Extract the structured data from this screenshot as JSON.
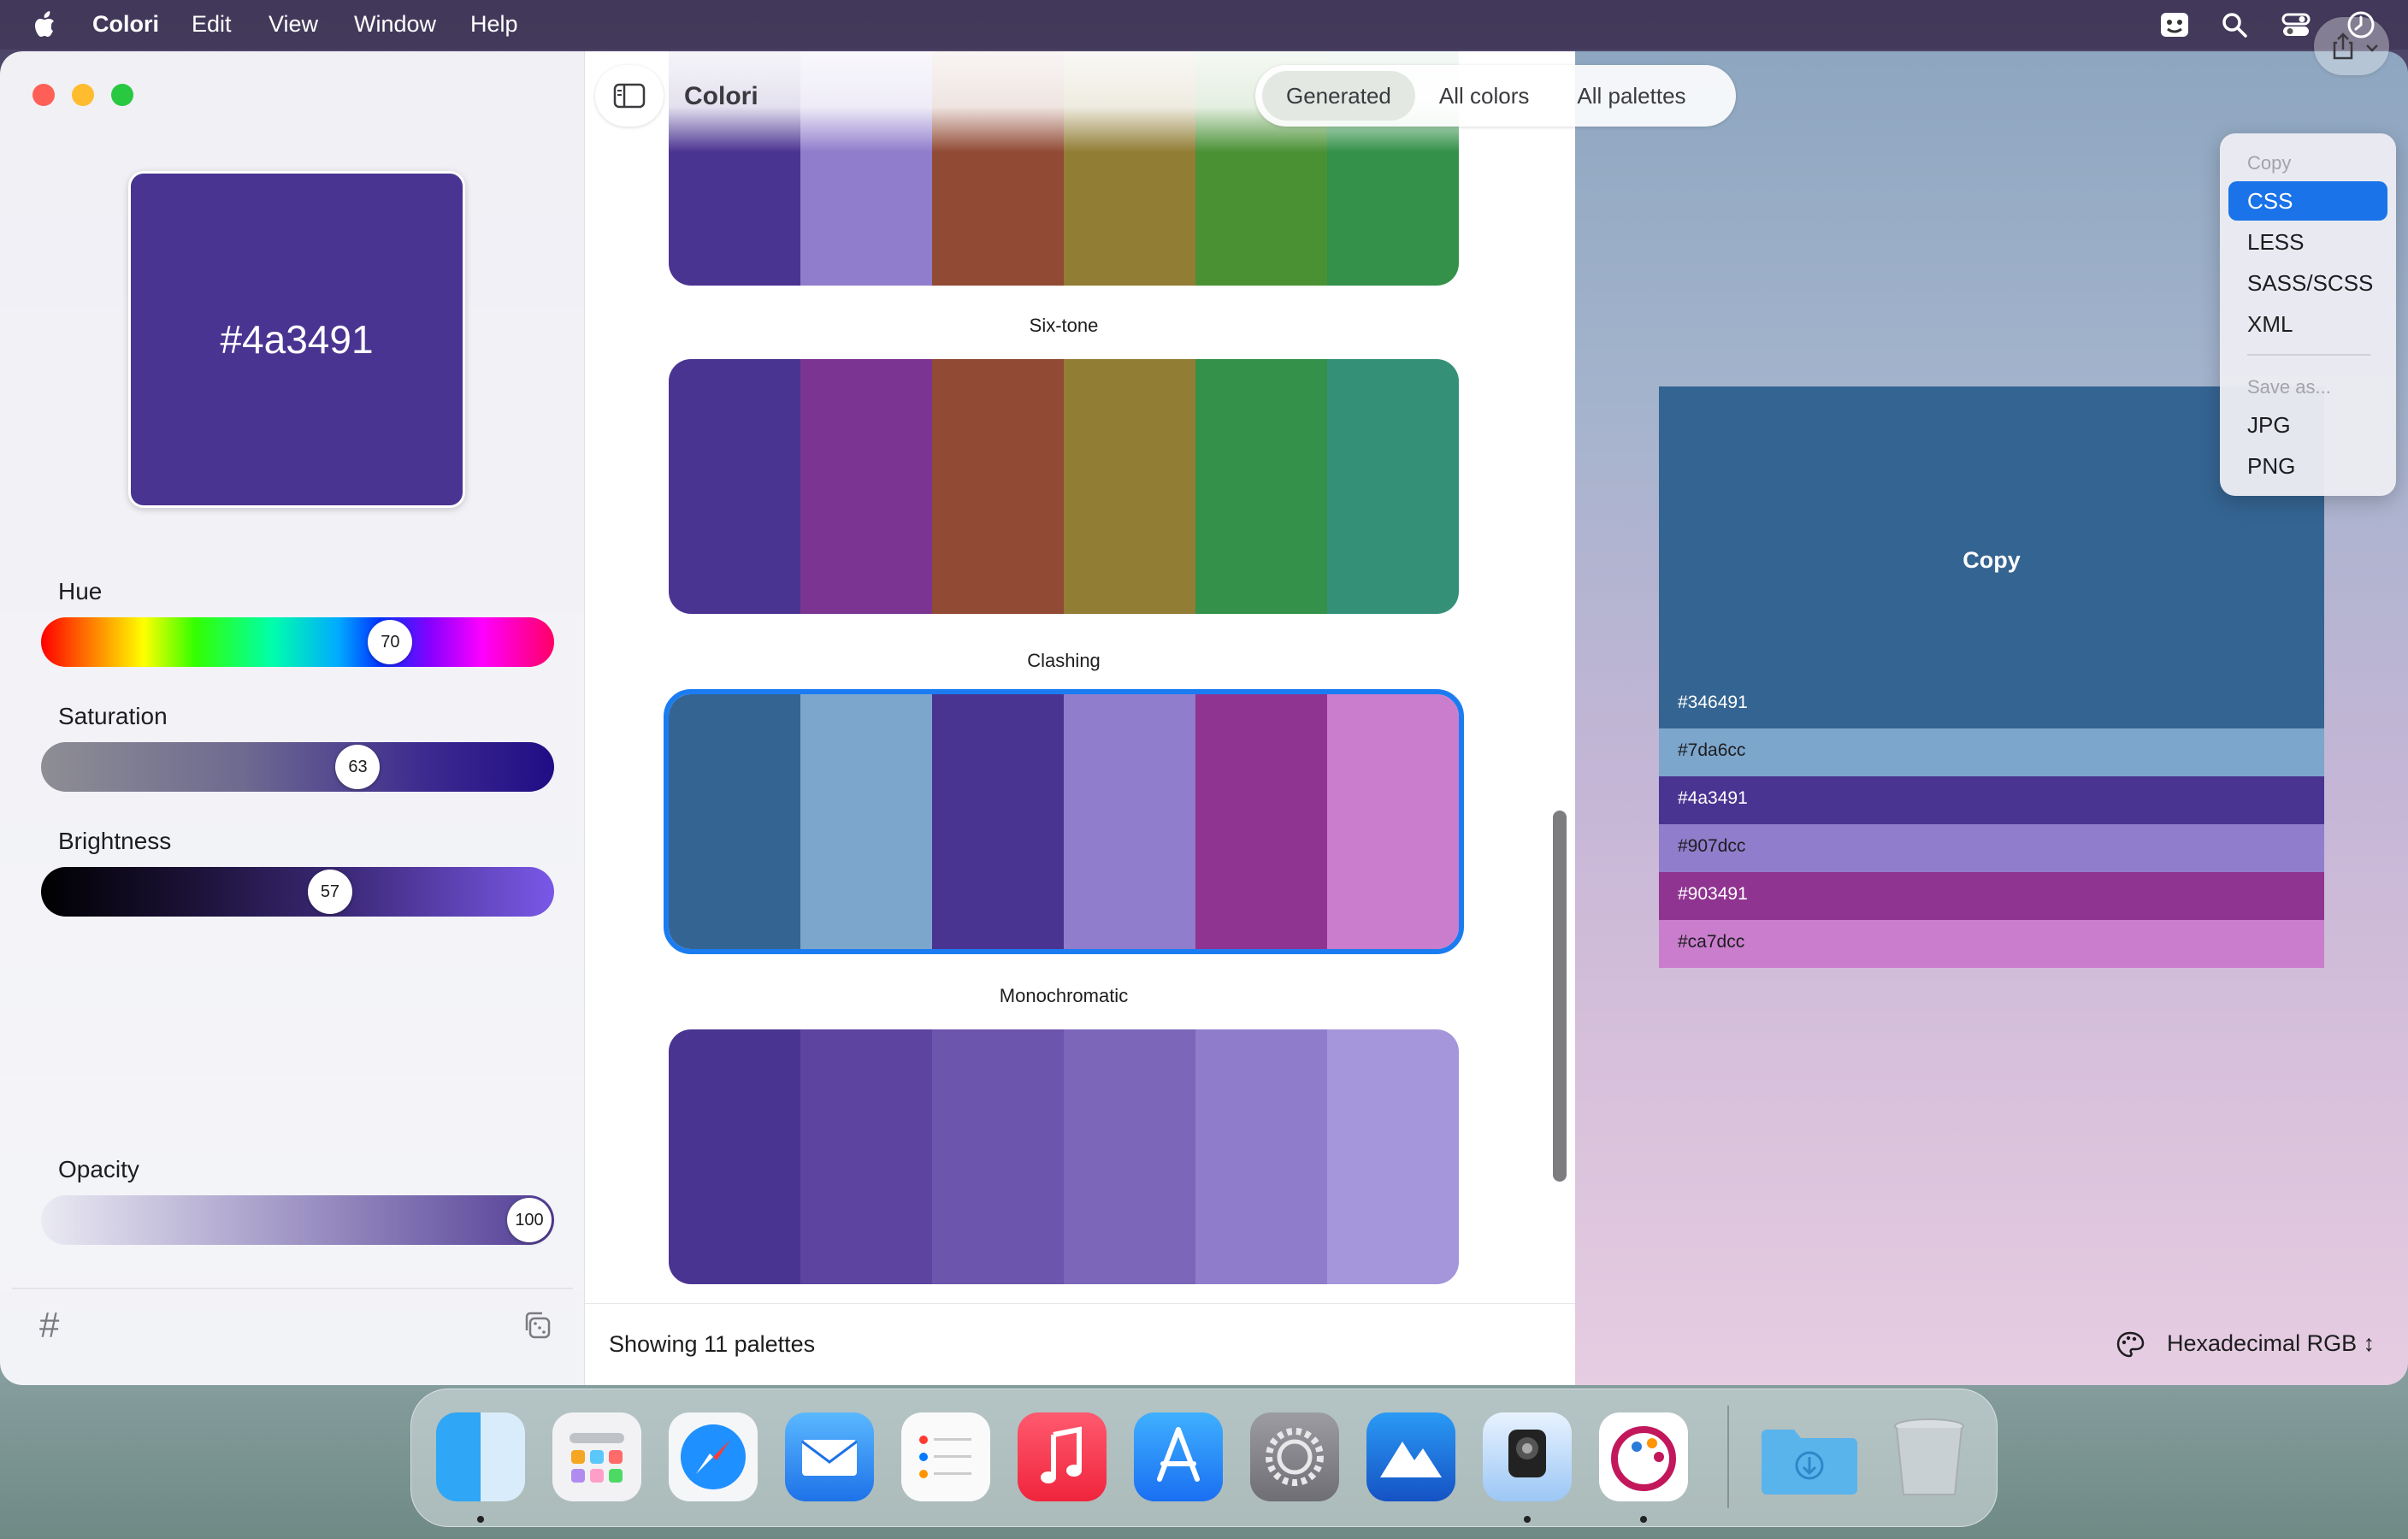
{
  "menubar": {
    "app_name": "Colori",
    "items": [
      "Edit",
      "View",
      "Window",
      "Help"
    ]
  },
  "sidebar": {
    "current_hex": "#4a3491",
    "current_color": "#4a3491",
    "hue": {
      "label": "Hue",
      "value": "70",
      "fraction": 0.7
    },
    "saturation": {
      "label": "Saturation",
      "value": "63",
      "fraction": 0.63
    },
    "brightness": {
      "label": "Brightness",
      "value": "57",
      "fraction": 0.57
    },
    "opacity": {
      "label": "Opacity",
      "value": "100",
      "fraction": 1.0
    },
    "hash_symbol": "#"
  },
  "toolbar": {
    "title": "Colori",
    "tabs": [
      {
        "label": "Generated",
        "active": true
      },
      {
        "label": "All colors",
        "active": false
      },
      {
        "label": "All palettes",
        "active": false
      }
    ]
  },
  "palettes": [
    {
      "title": "",
      "colors": [
        "#4a3491",
        "#907dcc",
        "#914a34",
        "#917d34",
        "#4a9134",
        "#349149"
      ]
    },
    {
      "title": "Six-tone",
      "colors": [
        "#4a3491",
        "#7b3491",
        "#914a34",
        "#917d34",
        "#349149",
        "#349178"
      ]
    },
    {
      "title": "Clashing",
      "colors": [
        "#346491",
        "#7da6cc",
        "#4a3491",
        "#907dcc",
        "#903491",
        "#ca7dcc"
      ],
      "selected": true
    },
    {
      "title": "Monochromatic",
      "colors": [
        "#4a3491",
        "#5d44a0",
        "#6c55ad",
        "#7c66b9",
        "#8f7dcc",
        "#a595da"
      ]
    }
  ],
  "status": {
    "count_text": "Showing 11 palettes"
  },
  "preview": {
    "copy_label": "Copy",
    "swatches": [
      {
        "hex": "#346491",
        "color": "#346491"
      },
      {
        "hex": "#7da6cc",
        "color": "#7da6cc"
      },
      {
        "hex": "#4a3491",
        "color": "#4a3491"
      },
      {
        "hex": "#907dcc",
        "color": "#907dcc"
      },
      {
        "hex": "#903491",
        "color": "#903491"
      },
      {
        "hex": "#ca7dcc",
        "color": "#ca7dcc"
      }
    ]
  },
  "format": {
    "label": "Hexadecimal RGB"
  },
  "dropdown": {
    "copy_header": "Copy",
    "copy_items": [
      "CSS",
      "LESS",
      "SASS/SCSS",
      "XML"
    ],
    "save_header": "Save as...",
    "save_items": [
      "JPG",
      "PNG"
    ],
    "highlighted": "CSS"
  },
  "dock": {
    "apps": [
      "finder-icon",
      "launchpad-icon",
      "safari-icon",
      "mail-icon",
      "reminders-icon",
      "music-icon",
      "app-store-icon",
      "system-settings-icon",
      "altitude-icon",
      "preview-lens-icon",
      "colori-icon",
      "downloads-folder-icon",
      "trash-icon"
    ]
  },
  "colors": {
    "accent": "#1a73e8",
    "selection_outline": "#1b7cf2"
  }
}
